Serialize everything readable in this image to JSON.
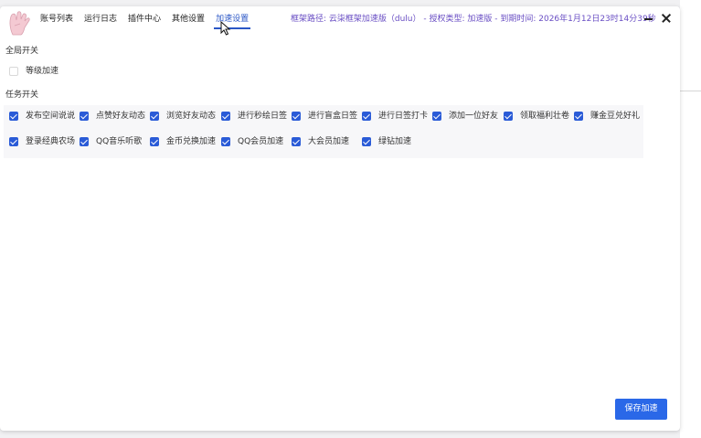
{
  "nav": {
    "items": [
      {
        "label": "账号列表",
        "active": false
      },
      {
        "label": "运行日志",
        "active": false
      },
      {
        "label": "插件中心",
        "active": false
      },
      {
        "label": "其他设置",
        "active": false
      },
      {
        "label": "加速设置",
        "active": true
      }
    ]
  },
  "info": {
    "text": "框架路径: 云柒框架加速版（dulu） - 授权类型: 加速版 - 到期时间: 2026年1月12日23时14分39秒"
  },
  "global": {
    "title": "全局开关",
    "items": [
      {
        "label": "等级加速",
        "checked": false
      }
    ]
  },
  "tasks": {
    "title": "任务开关",
    "items": [
      {
        "label": "发布空间说说",
        "checked": true
      },
      {
        "label": "点赞好友动态",
        "checked": true
      },
      {
        "label": "浏览好友动态",
        "checked": true
      },
      {
        "label": "进行秒绘日签",
        "checked": true
      },
      {
        "label": "进行盲盒日签",
        "checked": true
      },
      {
        "label": "进行日签打卡",
        "checked": true
      },
      {
        "label": "添加一位好友",
        "checked": true
      },
      {
        "label": "领取福利壮卷",
        "checked": true
      },
      {
        "label": "赚金豆兑好礼",
        "checked": true
      },
      {
        "label": "登录经典农场",
        "checked": true
      },
      {
        "label": "QQ音乐听歌",
        "checked": true
      },
      {
        "label": "金币兑换加速",
        "checked": true
      },
      {
        "label": "QQ会员加速",
        "checked": true
      },
      {
        "label": "大会员加速",
        "checked": true
      },
      {
        "label": "绿钻加速",
        "checked": true
      }
    ]
  },
  "actions": {
    "save_label": "保存加速"
  },
  "colors": {
    "accent": "#2a5bd7",
    "info_text": "#6a4fc4",
    "save_button": "#2a68e8"
  }
}
